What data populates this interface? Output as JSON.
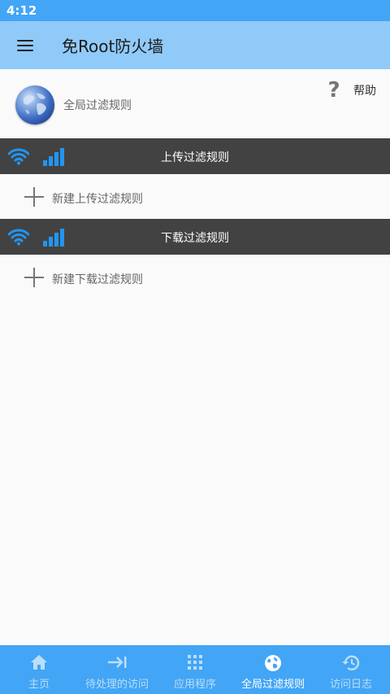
{
  "status_bar": {
    "time": "4:12"
  },
  "app_bar": {
    "title": "免Root防火墙",
    "menu_icon": "hamburger-menu-icon"
  },
  "global_filter": {
    "label": "全局过滤规则",
    "icon": "globe-icon"
  },
  "help": {
    "label": "帮助",
    "icon": "question-mark-icon"
  },
  "sections": {
    "upload": {
      "title": "上传过滤规则",
      "add_label": "新建上传过滤规则"
    },
    "download": {
      "title": "下载过滤规则",
      "add_label": "新建下载过滤规则"
    }
  },
  "bottom_nav": {
    "items": [
      {
        "label": "主页",
        "icon": "home-icon",
        "active": false
      },
      {
        "label": "待处理的访问",
        "icon": "arrow-to-bar-icon",
        "active": false
      },
      {
        "label": "应用程序",
        "icon": "apps-grid-icon",
        "active": false
      },
      {
        "label": "全局过滤规则",
        "icon": "globe-icon",
        "active": true
      },
      {
        "label": "访问日志",
        "icon": "history-icon",
        "active": false
      }
    ]
  },
  "colors": {
    "status_bar": "#42a5f5",
    "app_bar": "#90caf9",
    "section_header": "#424242",
    "accent_blue": "#2196f3",
    "nav_inactive": "#bbdefb",
    "nav_active": "#ffffff"
  }
}
